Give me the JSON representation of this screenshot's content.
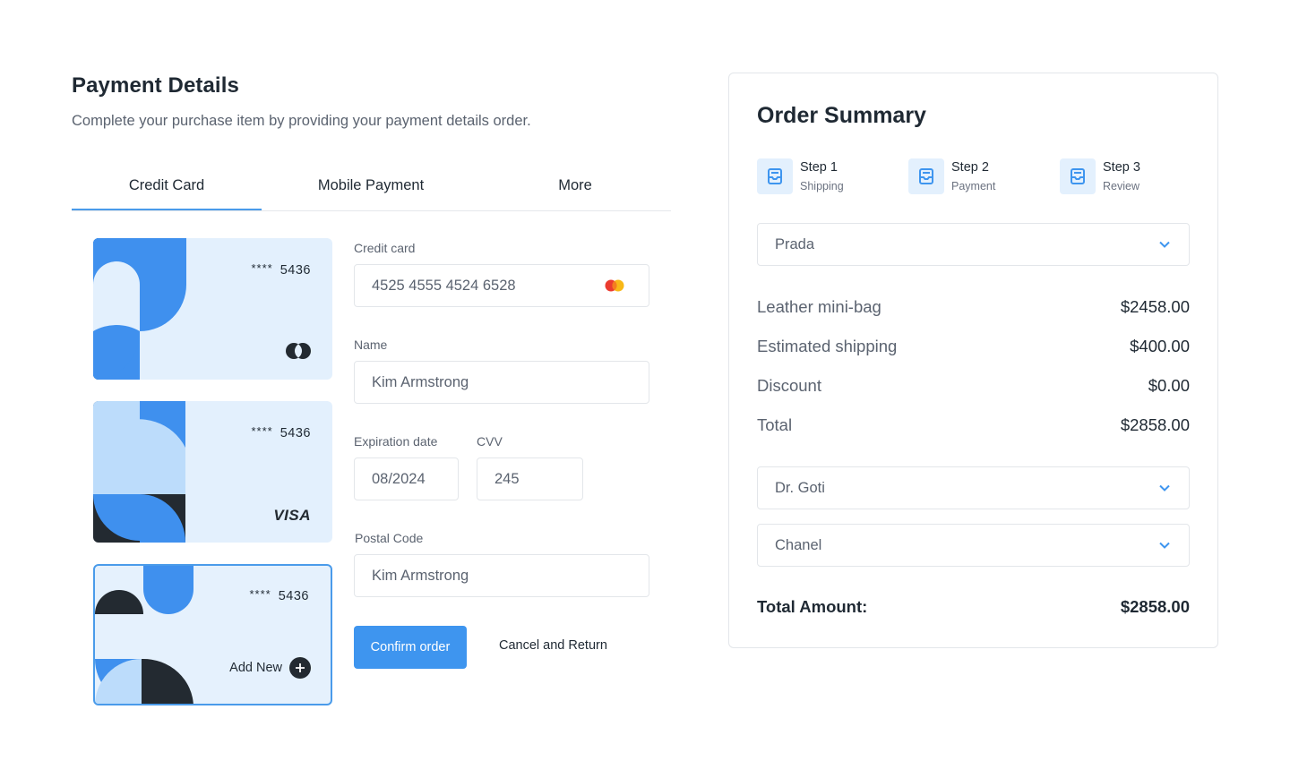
{
  "header": {
    "title": "Payment Details",
    "subtitle": "Complete your purchase item by providing your payment details order."
  },
  "tabs": [
    {
      "label": "Credit Card",
      "active": true
    },
    {
      "label": "Mobile Payment",
      "active": false
    },
    {
      "label": "More",
      "active": false
    }
  ],
  "cards": [
    {
      "masked": "****",
      "last4": "5436",
      "brand_icon": "mastercard-mono-icon"
    },
    {
      "masked": "****",
      "last4": "5436",
      "brand_label": "VISA"
    },
    {
      "masked": "****",
      "last4": "5436",
      "add_label": "Add New",
      "selected": true
    }
  ],
  "form": {
    "credit_card_label": "Credit card",
    "credit_card_value": "4525 4555 4524 6528",
    "name_label": "Name",
    "name_value": "Kim Armstrong",
    "expiration_label": "Expiration date",
    "expiration_value": "08/2024",
    "cvv_label": "CVV",
    "cvv_value": "245",
    "postal_label": "Postal Code",
    "postal_value": "Kim Armstrong",
    "confirm_label": "Confirm order",
    "cancel_label": "Cancel and Return"
  },
  "summary": {
    "title": "Order Summary",
    "steps": [
      {
        "title": "Step 1",
        "subtitle": "Shipping",
        "icon": "inbox-icon"
      },
      {
        "title": "Step 2",
        "subtitle": "Payment",
        "icon": "inbox-icon"
      },
      {
        "title": "Step 3",
        "subtitle": "Review",
        "icon": "inbox-icon"
      }
    ],
    "brand_select": "Prada",
    "rows": [
      {
        "label": "Leather mini-bag",
        "value": "$2458.00"
      },
      {
        "label": "Estimated shipping",
        "value": "$400.00"
      },
      {
        "label": "Discount",
        "value": "$0.00"
      },
      {
        "label": "Total",
        "value": "$2858.00"
      }
    ],
    "select_2": "Dr. Goti",
    "select_3": "Chanel",
    "total_amount_label": "Total Amount:",
    "total_amount_value": "$2858.00"
  },
  "colors": {
    "accent": "#3e95ef",
    "card_bg": "#e3f0fd",
    "card_dark": "#232a31",
    "card_blue": "#3f90ee",
    "card_light": "#bcdcfb"
  }
}
